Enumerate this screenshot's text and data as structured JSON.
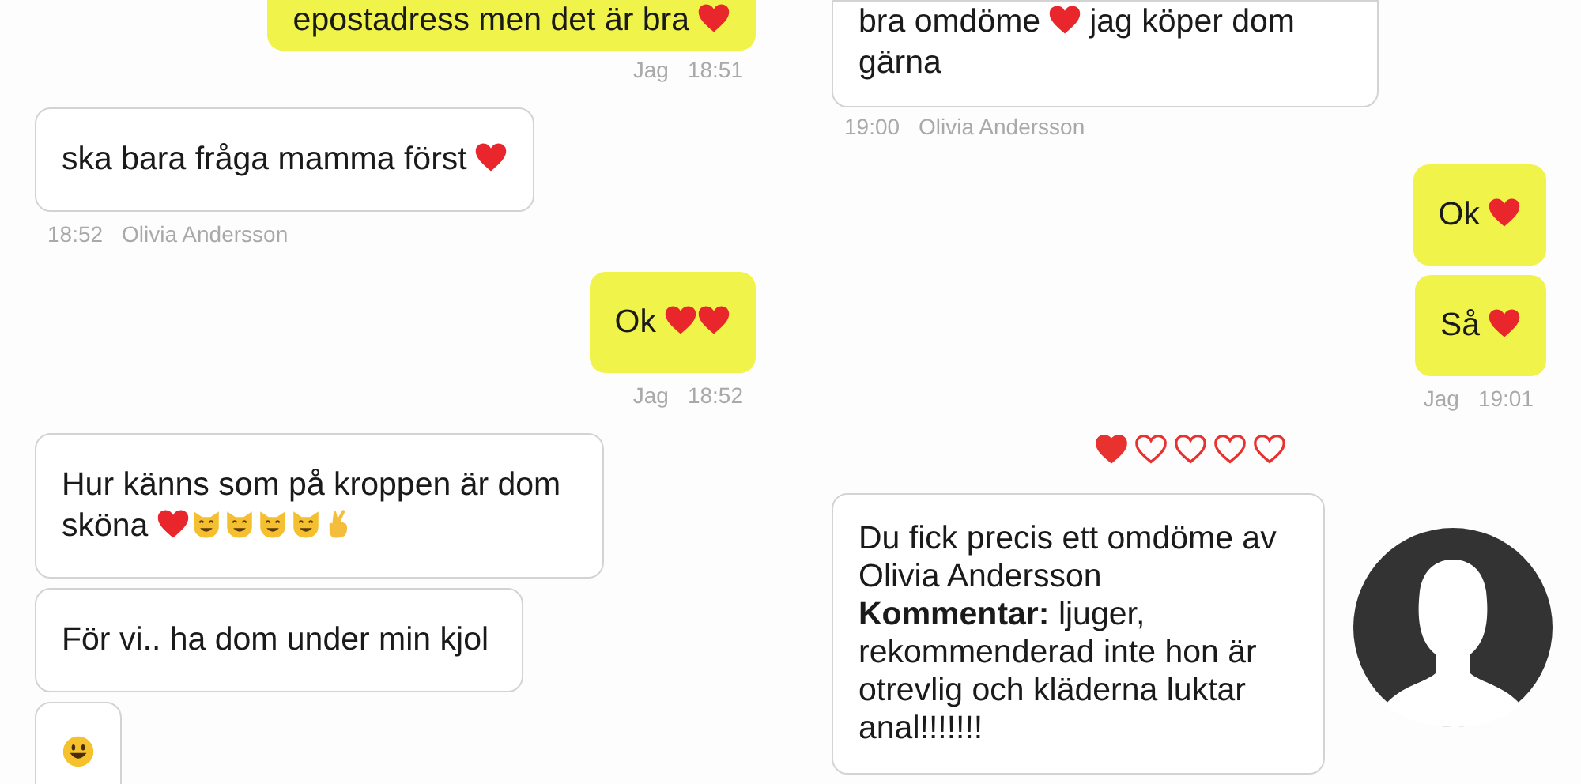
{
  "left_column": {
    "groups": [
      {
        "kind": "outgoing",
        "bubbles": [
          {
            "parts": [
              {
                "kind": "text",
                "text": "epostadress men det är bra"
              },
              {
                "kind": "heart"
              }
            ]
          }
        ],
        "meta": {
          "sender": "Jag",
          "time": "18:51"
        }
      },
      {
        "kind": "incoming",
        "bubbles": [
          {
            "parts": [
              {
                "kind": "text",
                "text": "ska bara fråga mamma först"
              },
              {
                "kind": "heart"
              }
            ]
          }
        ],
        "meta": {
          "sender": "Olivia Andersson",
          "time": "18:52"
        }
      },
      {
        "kind": "outgoing",
        "bubbles": [
          {
            "parts": [
              {
                "kind": "text",
                "text": "Ok"
              },
              {
                "kind": "heart"
              },
              {
                "kind": "heart"
              }
            ]
          }
        ],
        "meta": {
          "sender": "Jag",
          "time": "18:52"
        }
      },
      {
        "kind": "incoming",
        "bubbles": [
          {
            "parts": [
              {
                "kind": "text",
                "text": "Hur känns som på kroppen är dom"
              },
              {
                "kind": "text",
                "text": "sköna"
              },
              {
                "kind": "heart"
              },
              {
                "kind": "cat"
              },
              {
                "kind": "cat"
              },
              {
                "kind": "cat"
              },
              {
                "kind": "cat"
              },
              {
                "kind": "fingers"
              }
            ]
          },
          {
            "parts": [
              {
                "kind": "text",
                "text": "För vi.. ha dom under min kjol"
              }
            ]
          },
          {
            "parts": [
              {
                "kind": "smiley"
              }
            ]
          }
        ]
      }
    ]
  },
  "right_column": {
    "groups": [
      {
        "kind": "incoming",
        "bubbles": [
          {
            "parts": [
              {
                "kind": "text",
                "text": "bra omdöme"
              },
              {
                "kind": "heart"
              },
              {
                "kind": "text",
                "text": "jag köper dom"
              },
              {
                "kind": "text",
                "text": "gärna"
              }
            ]
          }
        ],
        "meta": {
          "sender": "Olivia Andersson",
          "time": "19:00"
        }
      },
      {
        "kind": "outgoing",
        "bubbles": [
          {
            "parts": [
              {
                "kind": "text",
                "text": "Ok"
              },
              {
                "kind": "heart"
              }
            ]
          },
          {
            "parts": [
              {
                "kind": "text",
                "text": "Så"
              },
              {
                "kind": "heart"
              }
            ]
          }
        ],
        "meta": {
          "sender": "Jag",
          "time": "19:01"
        }
      }
    ],
    "rating": {
      "stars": 1
    },
    "review": {
      "paragraphs": [
        "Du fick precis ett omdöme av Olivia Andersson",
        "**Kommentar:** ljuger, rekommenderad inte hon är otrevlig och kläderna luktar anal!!!!!!!"
      ]
    }
  }
}
